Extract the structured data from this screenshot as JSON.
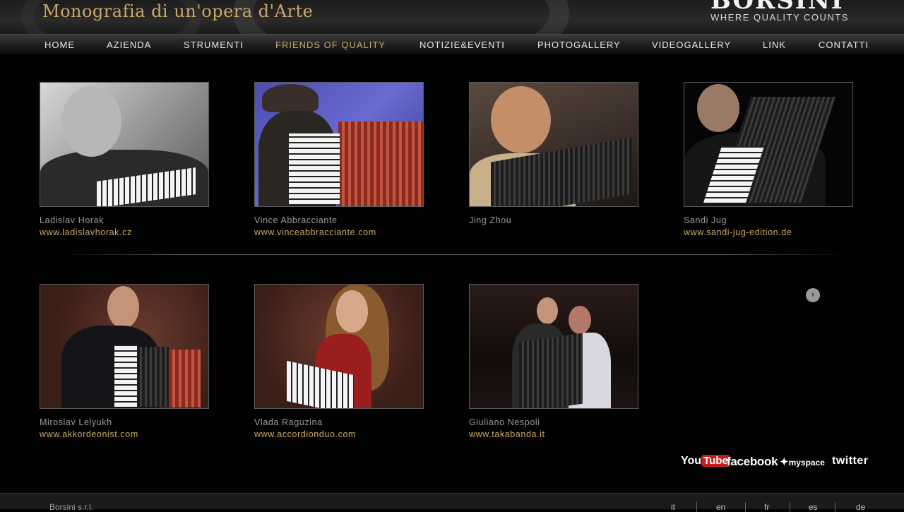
{
  "header": {
    "site_title": "Monografia di un'opera d'Arte",
    "brand_name": "BORSINI",
    "brand_tagline": "WHERE QUALITY COUNTS"
  },
  "nav": {
    "items": [
      {
        "label": "HOME"
      },
      {
        "label": "AZIENDA"
      },
      {
        "label": "STRUMENTI"
      },
      {
        "label": "FRIENDS OF QUALITY",
        "active": true
      },
      {
        "label": "NOTIZIE&EVENTI"
      },
      {
        "label": "PHOTOGALLERY"
      },
      {
        "label": "VIDEOGALLERY"
      },
      {
        "label": "LINK"
      },
      {
        "label": "CONTATTI"
      }
    ]
  },
  "friends": [
    {
      "name": "Ladislav Horak",
      "link": "www.ladislavhorak.cz"
    },
    {
      "name": "Vince Abbracciante",
      "link": "www.vinceabbracciante.com"
    },
    {
      "name": "Jing Zhou",
      "link": ""
    },
    {
      "name": "Sandi Jug",
      "link": "www.sandi-jug-edition.de"
    },
    {
      "name": "Miroslav Lelyukh",
      "link": "www.akkordeonist.com"
    },
    {
      "name": "Vlada Raguzina",
      "link": "www.accordionduo.com"
    },
    {
      "name": "Giuliano Nespoli",
      "link": "www.takabanda.it"
    }
  ],
  "next_arrow": "›",
  "social": {
    "youtube_you": "You",
    "youtube_tube": "Tube",
    "facebook": "facebook",
    "myspace": "myspace",
    "twitter": "twitter"
  },
  "footer": {
    "company": "Borsini s.r.l.",
    "languages": [
      "it",
      "en",
      "fr",
      "es",
      "de"
    ]
  },
  "colors": {
    "accent": "#c9a86a",
    "background": "#020202",
    "text": "#9a9a9a"
  }
}
